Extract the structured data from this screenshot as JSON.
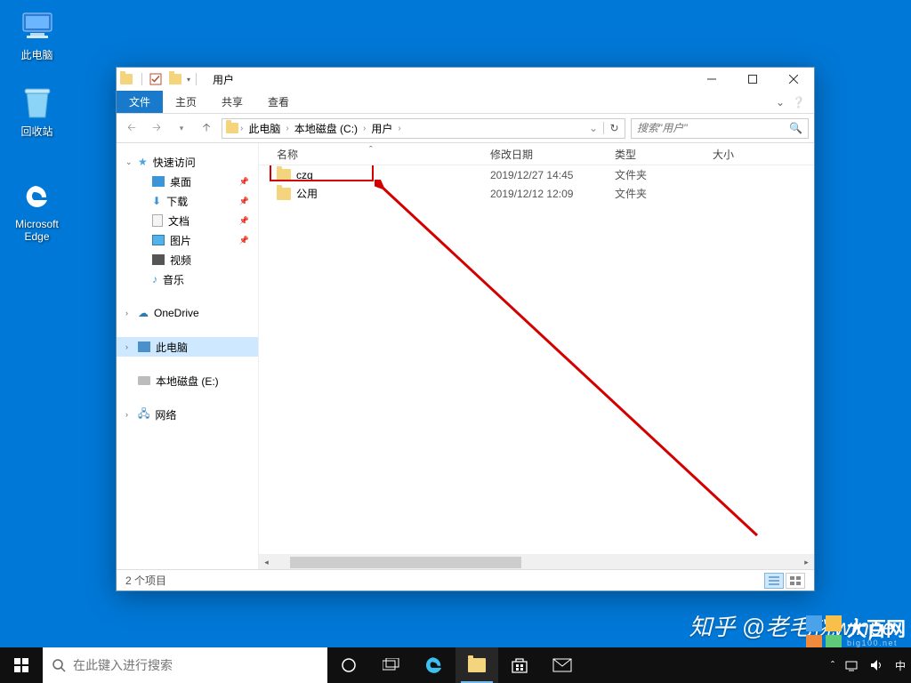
{
  "desktop": {
    "my_computer": "此电脑",
    "recycle_bin": "回收站",
    "edge": "Microsoft Edge"
  },
  "taskbar": {
    "search_placeholder": "在此键入进行搜索",
    "tray_ime": "中"
  },
  "window": {
    "title": "用户",
    "tabs": {
      "file": "文件",
      "home": "主页",
      "share": "共享",
      "view": "查看"
    },
    "breadcrumb": {
      "pc": "此电脑",
      "drive": "本地磁盘 (C:)",
      "users": "用户"
    },
    "search_placeholder": "搜索\"用户\"",
    "nav": {
      "quick": "快速访问",
      "desktop": "桌面",
      "downloads": "下载",
      "documents": "文档",
      "pictures": "图片",
      "videos": "视频",
      "music": "音乐",
      "onedrive": "OneDrive",
      "thispc": "此电脑",
      "drive_e": "本地磁盘 (E:)",
      "network": "网络"
    },
    "columns": {
      "name": "名称",
      "modified": "修改日期",
      "type": "类型",
      "size": "大小"
    },
    "rows": [
      {
        "name": "czq",
        "modified": "2019/12/27 14:45",
        "type": "文件夹",
        "size": ""
      },
      {
        "name": "公用",
        "modified": "2019/12/12 12:09",
        "type": "文件夹",
        "size": ""
      }
    ],
    "status": "2 个项目"
  },
  "watermark1": "知乎 @老毛桃winpe",
  "watermark2": {
    "name": "大百网",
    "sub": "big100.net"
  },
  "colors": {
    "accent": "#1979ca",
    "highlight": "#d40000"
  }
}
